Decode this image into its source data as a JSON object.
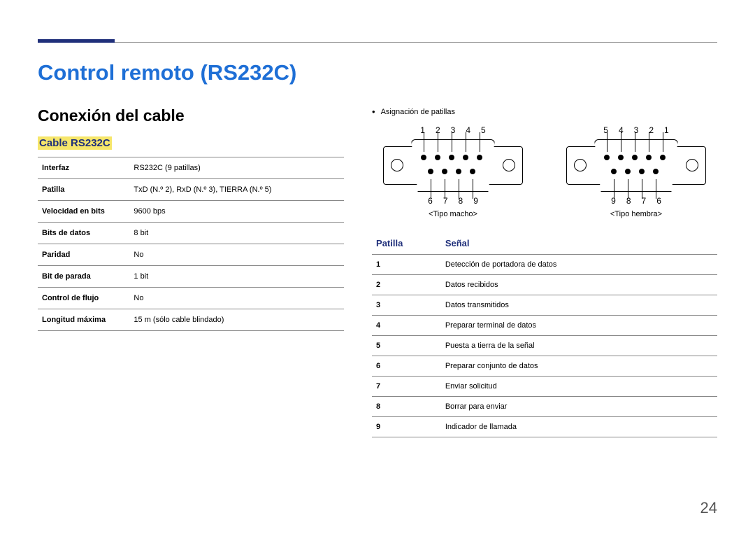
{
  "title": "Control remoto (RS232C)",
  "section": "Conexión del cable",
  "subsection": "Cable RS232C",
  "spec_rows": [
    {
      "key": "Interfaz",
      "val": "RS232C (9 patillas)"
    },
    {
      "key": "Patilla",
      "val": "TxD (N.º 2), RxD (N.º 3), TIERRA (N.º 5)"
    },
    {
      "key": "Velocidad en bits",
      "val": "9600 bps"
    },
    {
      "key": "Bits de datos",
      "val": "8 bit"
    },
    {
      "key": "Paridad",
      "val": "No"
    },
    {
      "key": "Bit de parada",
      "val": "1 bit"
    },
    {
      "key": "Control de flujo",
      "val": "No"
    },
    {
      "key": "Longitud máxima",
      "val": "15 m (sólo cable blindado)"
    }
  ],
  "pin_assignment_label": "Asignación de patillas",
  "connector_male": {
    "top_pins": [
      "1",
      "2",
      "3",
      "4",
      "5"
    ],
    "bottom_pins": [
      "6",
      "7",
      "8",
      "9"
    ],
    "label": "<Tipo macho>"
  },
  "connector_female": {
    "top_pins": [
      "5",
      "4",
      "3",
      "2",
      "1"
    ],
    "bottom_pins": [
      "9",
      "8",
      "7",
      "6"
    ],
    "label": "<Tipo hembra>"
  },
  "signal_table": {
    "header_pin": "Patilla",
    "header_signal": "Señal",
    "rows": [
      {
        "pin": "1",
        "signal": "Detección de portadora de datos"
      },
      {
        "pin": "2",
        "signal": "Datos recibidos"
      },
      {
        "pin": "3",
        "signal": "Datos transmitidos"
      },
      {
        "pin": "4",
        "signal": "Preparar terminal de datos"
      },
      {
        "pin": "5",
        "signal": "Puesta a tierra de la señal"
      },
      {
        "pin": "6",
        "signal": "Preparar conjunto de datos"
      },
      {
        "pin": "7",
        "signal": "Enviar solicitud"
      },
      {
        "pin": "8",
        "signal": "Borrar para enviar"
      },
      {
        "pin": "9",
        "signal": "Indicador de llamada"
      }
    ]
  },
  "page_number": "24"
}
